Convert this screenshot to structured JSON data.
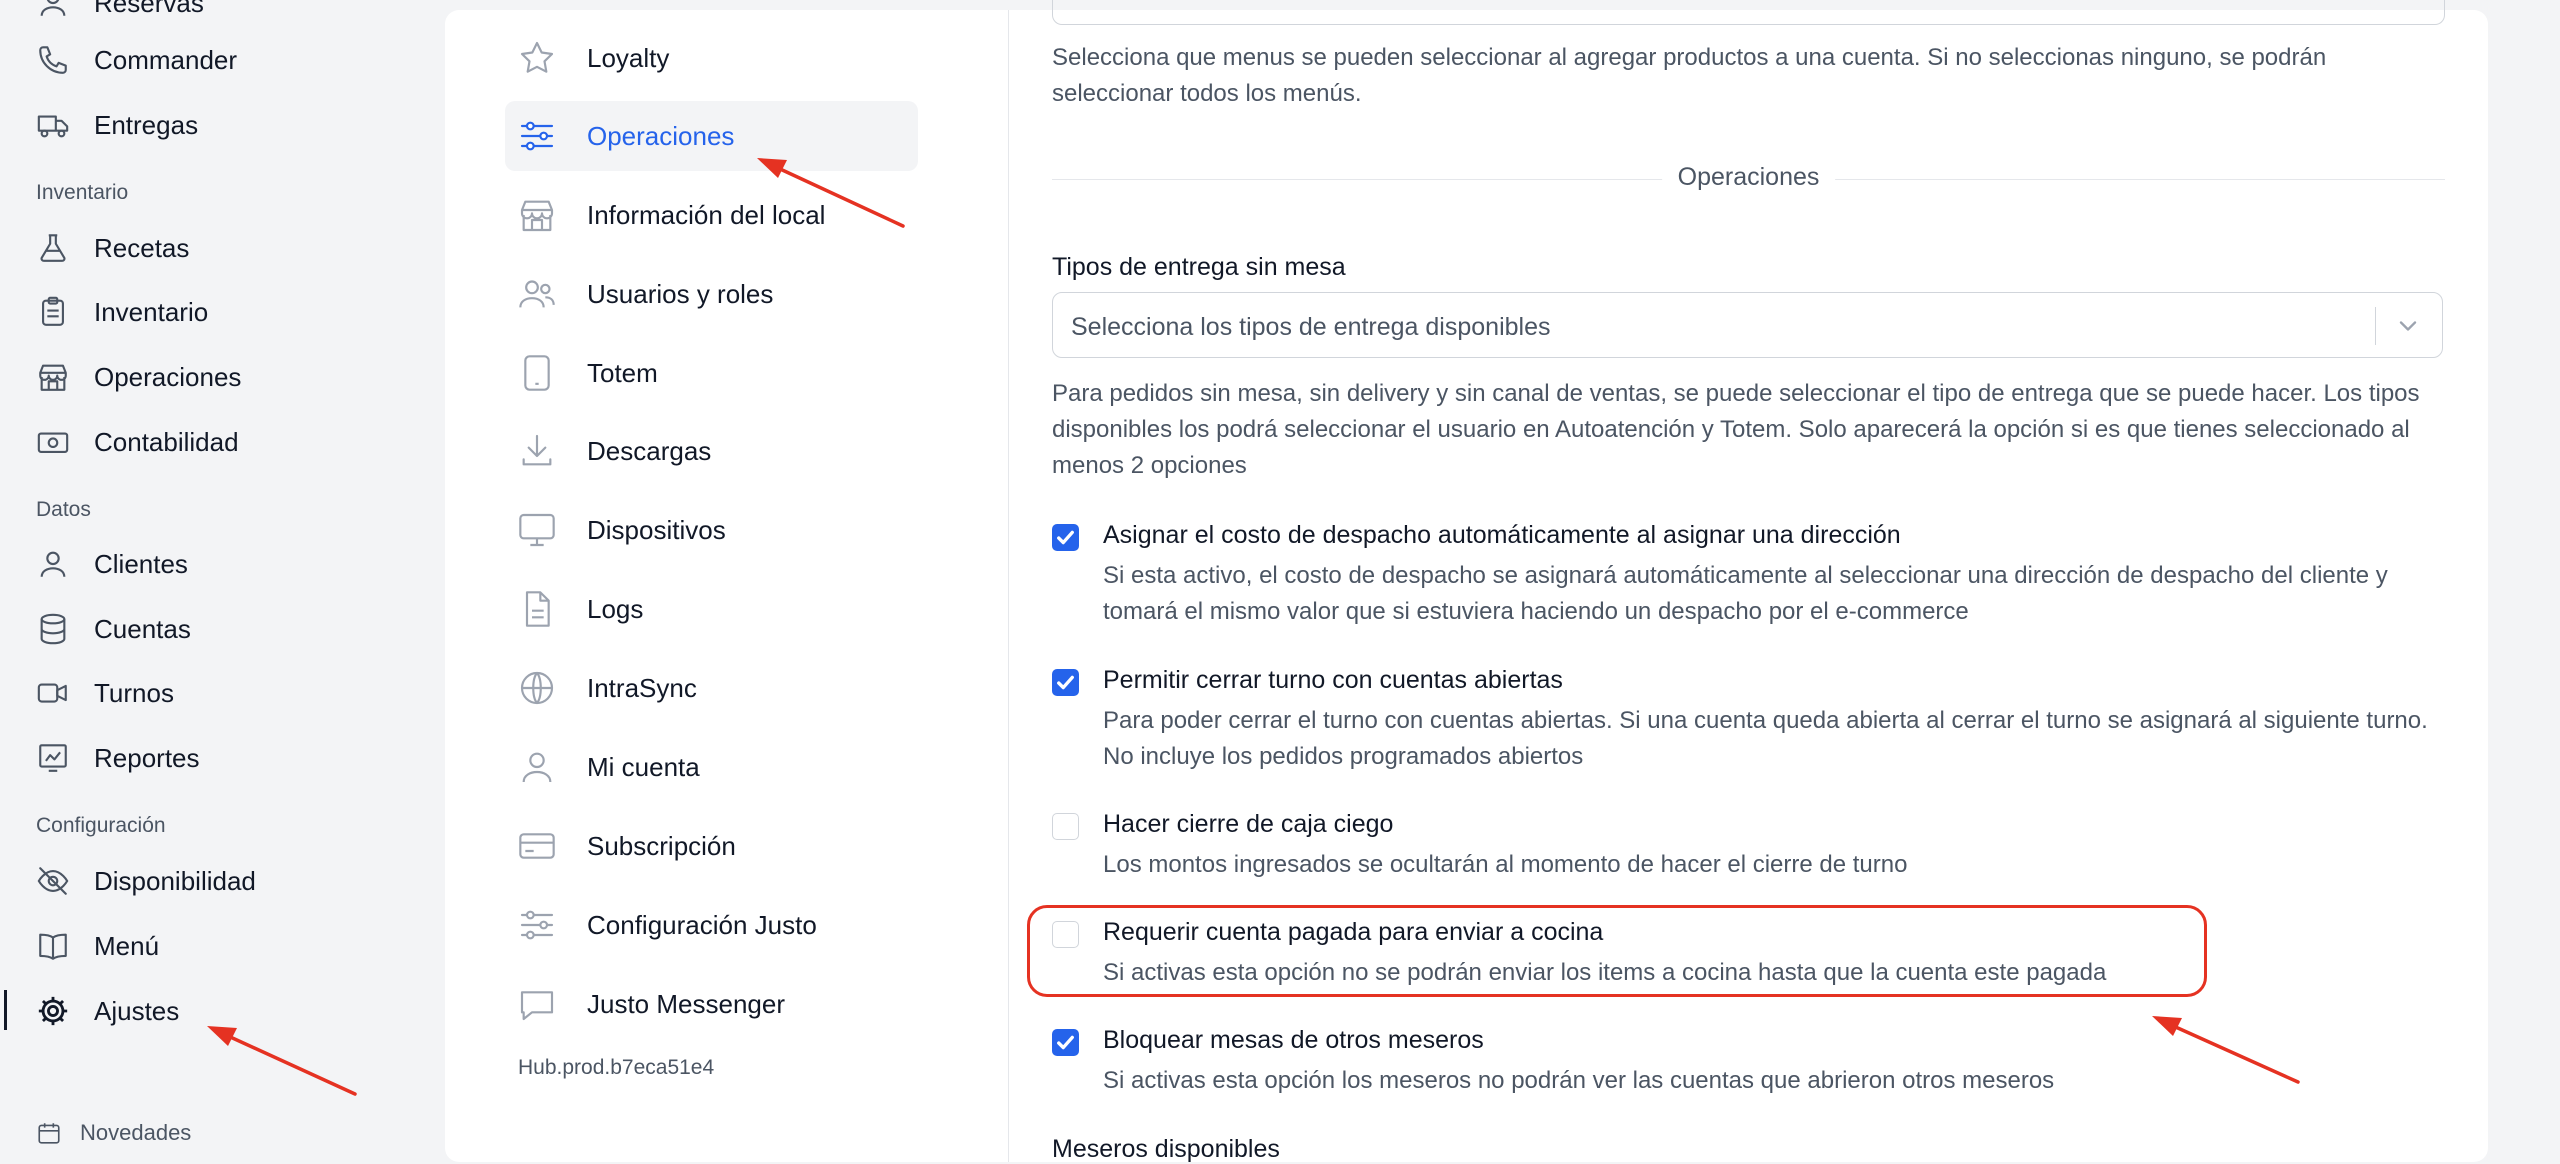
{
  "sidebar": {
    "partial_top": "Reservas",
    "items_top": [
      {
        "label": "Commander",
        "icon": "phone-icon"
      },
      {
        "label": "Entregas",
        "icon": "truck-icon"
      }
    ],
    "sections": [
      {
        "label": "Inventario",
        "items": [
          {
            "label": "Recetas",
            "icon": "flask-icon"
          },
          {
            "label": "Inventario",
            "icon": "clipboard-icon"
          },
          {
            "label": "Operaciones",
            "icon": "store-icon"
          },
          {
            "label": "Contabilidad",
            "icon": "cash-icon"
          }
        ]
      },
      {
        "label": "Datos",
        "items": [
          {
            "label": "Clientes",
            "icon": "user-icon"
          },
          {
            "label": "Cuentas",
            "icon": "database-icon"
          },
          {
            "label": "Turnos",
            "icon": "video-icon"
          },
          {
            "label": "Reportes",
            "icon": "chart-icon"
          }
        ]
      },
      {
        "label": "Configuración",
        "items": [
          {
            "label": "Disponibilidad",
            "icon": "eye-slash-icon"
          },
          {
            "label": "Menú",
            "icon": "book-icon"
          },
          {
            "label": "Ajustes",
            "icon": "gear-icon"
          }
        ]
      }
    ],
    "active": "Ajustes",
    "bottom": {
      "label": "Novedades",
      "icon": "calendar-icon"
    }
  },
  "settings_nav": {
    "items": [
      {
        "label": "Loyalty",
        "icon": "star-icon"
      },
      {
        "label": "Operaciones",
        "icon": "sliders-icon"
      },
      {
        "label": "Información del local",
        "icon": "store-icon"
      },
      {
        "label": "Usuarios y roles",
        "icon": "users-icon"
      },
      {
        "label": "Totem",
        "icon": "tablet-icon"
      },
      {
        "label": "Descargas",
        "icon": "download-icon"
      },
      {
        "label": "Dispositivos",
        "icon": "monitor-icon"
      },
      {
        "label": "Logs",
        "icon": "document-icon"
      },
      {
        "label": "IntraSync",
        "icon": "globe-icon"
      },
      {
        "label": "Mi cuenta",
        "icon": "user-icon"
      },
      {
        "label": "Subscripción",
        "icon": "credit-card-icon"
      },
      {
        "label": "Configuración Justo",
        "icon": "sliders-icon"
      },
      {
        "label": "Justo Messenger",
        "icon": "chat-icon"
      }
    ],
    "active": "Operaciones",
    "version": "Hub.prod.b7eca51e4"
  },
  "content": {
    "menus_help": "Selecciona que menus se pueden seleccionar al agregar productos a una cuenta. Si no seleccionas ninguno, se podrán seleccionar todos los menús.",
    "section_title": "Operaciones",
    "delivery_types": {
      "label": "Tipos de entrega sin mesa",
      "placeholder": "Selecciona los tipos de entrega disponibles",
      "help": "Para pedidos sin mesa, sin delivery y sin canal de ventas, se puede seleccionar el tipo de entrega que se puede hacer. Los tipos disponibles los podrá seleccionar el usuario en Autoatención y Totem. Solo aparecerá la opción si es que tienes seleccionado al menos 2 opciones"
    },
    "options": [
      {
        "title": "Asignar el costo de despacho automáticamente al asignar una dirección",
        "desc": "Si esta activo, el costo de despacho se asignará automáticamente al seleccionar una dirección de despacho del cliente y tomará el mismo valor que si estuviera haciendo un despacho por el e-commerce",
        "checked": true
      },
      {
        "title": "Permitir cerrar turno con cuentas abiertas",
        "desc": "Para poder cerrar el turno con cuentas abiertas. Si una cuenta queda abierta al cerrar el turno se asignará al siguiente turno. No incluye los pedidos programados abiertos",
        "checked": true
      },
      {
        "title": "Hacer cierre de caja ciego",
        "desc": "Los montos ingresados se ocultarán al momento de hacer el cierre de turno",
        "checked": false
      },
      {
        "title": "Requerir cuenta pagada para enviar a cocina",
        "desc": "Si activas esta opción no se podrán enviar los items a cocina hasta que la cuenta este pagada",
        "checked": false
      },
      {
        "title": "Bloquear mesas de otros meseros",
        "desc": "Si activas esta opción los meseros no podrán ver las cuentas que abrieron otros meseros",
        "checked": true
      }
    ],
    "next_section": "Meseros disponibles"
  },
  "colors": {
    "accent": "#2563eb",
    "annotation": "#e53222",
    "background": "#f3f4f6"
  }
}
